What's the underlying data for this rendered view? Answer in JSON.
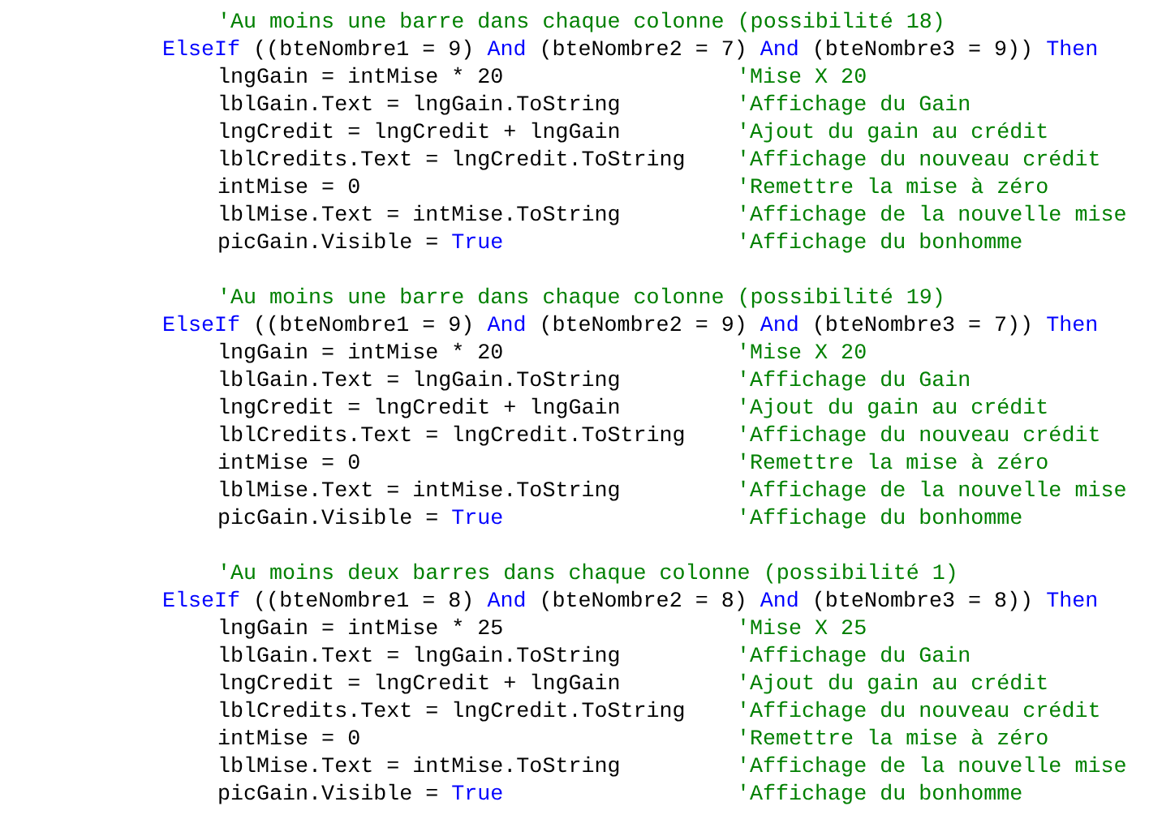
{
  "blocks": [
    {
      "comment": "'Au moins une barre dans chaque colonne (possibilité 18)",
      "condition": [
        {
          "kind": "keyword",
          "text": "ElseIf"
        },
        {
          "kind": "plain",
          "text": " ((bteNombre1 = 9) "
        },
        {
          "kind": "keyword",
          "text": "And"
        },
        {
          "kind": "plain",
          "text": " (bteNombre2 = 7) "
        },
        {
          "kind": "keyword",
          "text": "And"
        },
        {
          "kind": "plain",
          "text": " (bteNombre3 = 9)) "
        },
        {
          "kind": "keyword",
          "text": "Then"
        }
      ],
      "statements": [
        {
          "code": [
            {
              "kind": "plain",
              "text": "lngGain = intMise * 20"
            }
          ],
          "comment": "'Mise X 20"
        },
        {
          "code": [
            {
              "kind": "plain",
              "text": "lblGain.Text = lngGain.ToString"
            }
          ],
          "comment": "'Affichage du Gain"
        },
        {
          "code": [
            {
              "kind": "plain",
              "text": "lngCredit = lngCredit + lngGain"
            }
          ],
          "comment": "'Ajout du gain au crédit"
        },
        {
          "code": [
            {
              "kind": "plain",
              "text": "lblCredits.Text = lngCredit.ToString"
            }
          ],
          "comment": "'Affichage du nouveau crédit"
        },
        {
          "code": [
            {
              "kind": "plain",
              "text": "intMise = 0"
            }
          ],
          "comment": "'Remettre la mise à zéro"
        },
        {
          "code": [
            {
              "kind": "plain",
              "text": "lblMise.Text = intMise.ToString"
            }
          ],
          "comment": "'Affichage de la nouvelle mise"
        },
        {
          "code": [
            {
              "kind": "plain",
              "text": "picGain.Visible = "
            },
            {
              "kind": "keyword",
              "text": "True"
            }
          ],
          "comment": "'Affichage du bonhomme"
        }
      ]
    },
    {
      "comment": "'Au moins une barre dans chaque colonne (possibilité 19)",
      "condition": [
        {
          "kind": "keyword",
          "text": "ElseIf"
        },
        {
          "kind": "plain",
          "text": " ((bteNombre1 = 9) "
        },
        {
          "kind": "keyword",
          "text": "And"
        },
        {
          "kind": "plain",
          "text": " (bteNombre2 = 9) "
        },
        {
          "kind": "keyword",
          "text": "And"
        },
        {
          "kind": "plain",
          "text": " (bteNombre3 = 7)) "
        },
        {
          "kind": "keyword",
          "text": "Then"
        }
      ],
      "statements": [
        {
          "code": [
            {
              "kind": "plain",
              "text": "lngGain = intMise * 20"
            }
          ],
          "comment": "'Mise X 20"
        },
        {
          "code": [
            {
              "kind": "plain",
              "text": "lblGain.Text = lngGain.ToString"
            }
          ],
          "comment": "'Affichage du Gain"
        },
        {
          "code": [
            {
              "kind": "plain",
              "text": "lngCredit = lngCredit + lngGain"
            }
          ],
          "comment": "'Ajout du gain au crédit"
        },
        {
          "code": [
            {
              "kind": "plain",
              "text": "lblCredits.Text = lngCredit.ToString"
            }
          ],
          "comment": "'Affichage du nouveau crédit"
        },
        {
          "code": [
            {
              "kind": "plain",
              "text": "intMise = 0"
            }
          ],
          "comment": "'Remettre la mise à zéro"
        },
        {
          "code": [
            {
              "kind": "plain",
              "text": "lblMise.Text = intMise.ToString"
            }
          ],
          "comment": "'Affichage de la nouvelle mise"
        },
        {
          "code": [
            {
              "kind": "plain",
              "text": "picGain.Visible = "
            },
            {
              "kind": "keyword",
              "text": "True"
            }
          ],
          "comment": "'Affichage du bonhomme"
        }
      ]
    },
    {
      "comment": "'Au moins deux barres dans chaque colonne (possibilité 1)",
      "condition": [
        {
          "kind": "keyword",
          "text": "ElseIf"
        },
        {
          "kind": "plain",
          "text": " ((bteNombre1 = 8) "
        },
        {
          "kind": "keyword",
          "text": "And"
        },
        {
          "kind": "plain",
          "text": " (bteNombre2 = 8) "
        },
        {
          "kind": "keyword",
          "text": "And"
        },
        {
          "kind": "plain",
          "text": " (bteNombre3 = 8)) "
        },
        {
          "kind": "keyword",
          "text": "Then"
        }
      ],
      "statements": [
        {
          "code": [
            {
              "kind": "plain",
              "text": "lngGain = intMise * 25"
            }
          ],
          "comment": "'Mise X 25"
        },
        {
          "code": [
            {
              "kind": "plain",
              "text": "lblGain.Text = lngGain.ToString"
            }
          ],
          "comment": "'Affichage du Gain"
        },
        {
          "code": [
            {
              "kind": "plain",
              "text": "lngCredit = lngCredit + lngGain"
            }
          ],
          "comment": "'Ajout du gain au crédit"
        },
        {
          "code": [
            {
              "kind": "plain",
              "text": "lblCredits.Text = lngCredit.ToString"
            }
          ],
          "comment": "'Affichage du nouveau crédit"
        },
        {
          "code": [
            {
              "kind": "plain",
              "text": "intMise = 0"
            }
          ],
          "comment": "'Remettre la mise à zéro"
        },
        {
          "code": [
            {
              "kind": "plain",
              "text": "lblMise.Text = intMise.ToString"
            }
          ],
          "comment": "'Affichage de la nouvelle mise"
        },
        {
          "code": [
            {
              "kind": "plain",
              "text": "picGain.Visible = "
            },
            {
              "kind": "keyword",
              "text": "True"
            }
          ],
          "comment": "'Affichage du bonhomme"
        }
      ]
    }
  ]
}
